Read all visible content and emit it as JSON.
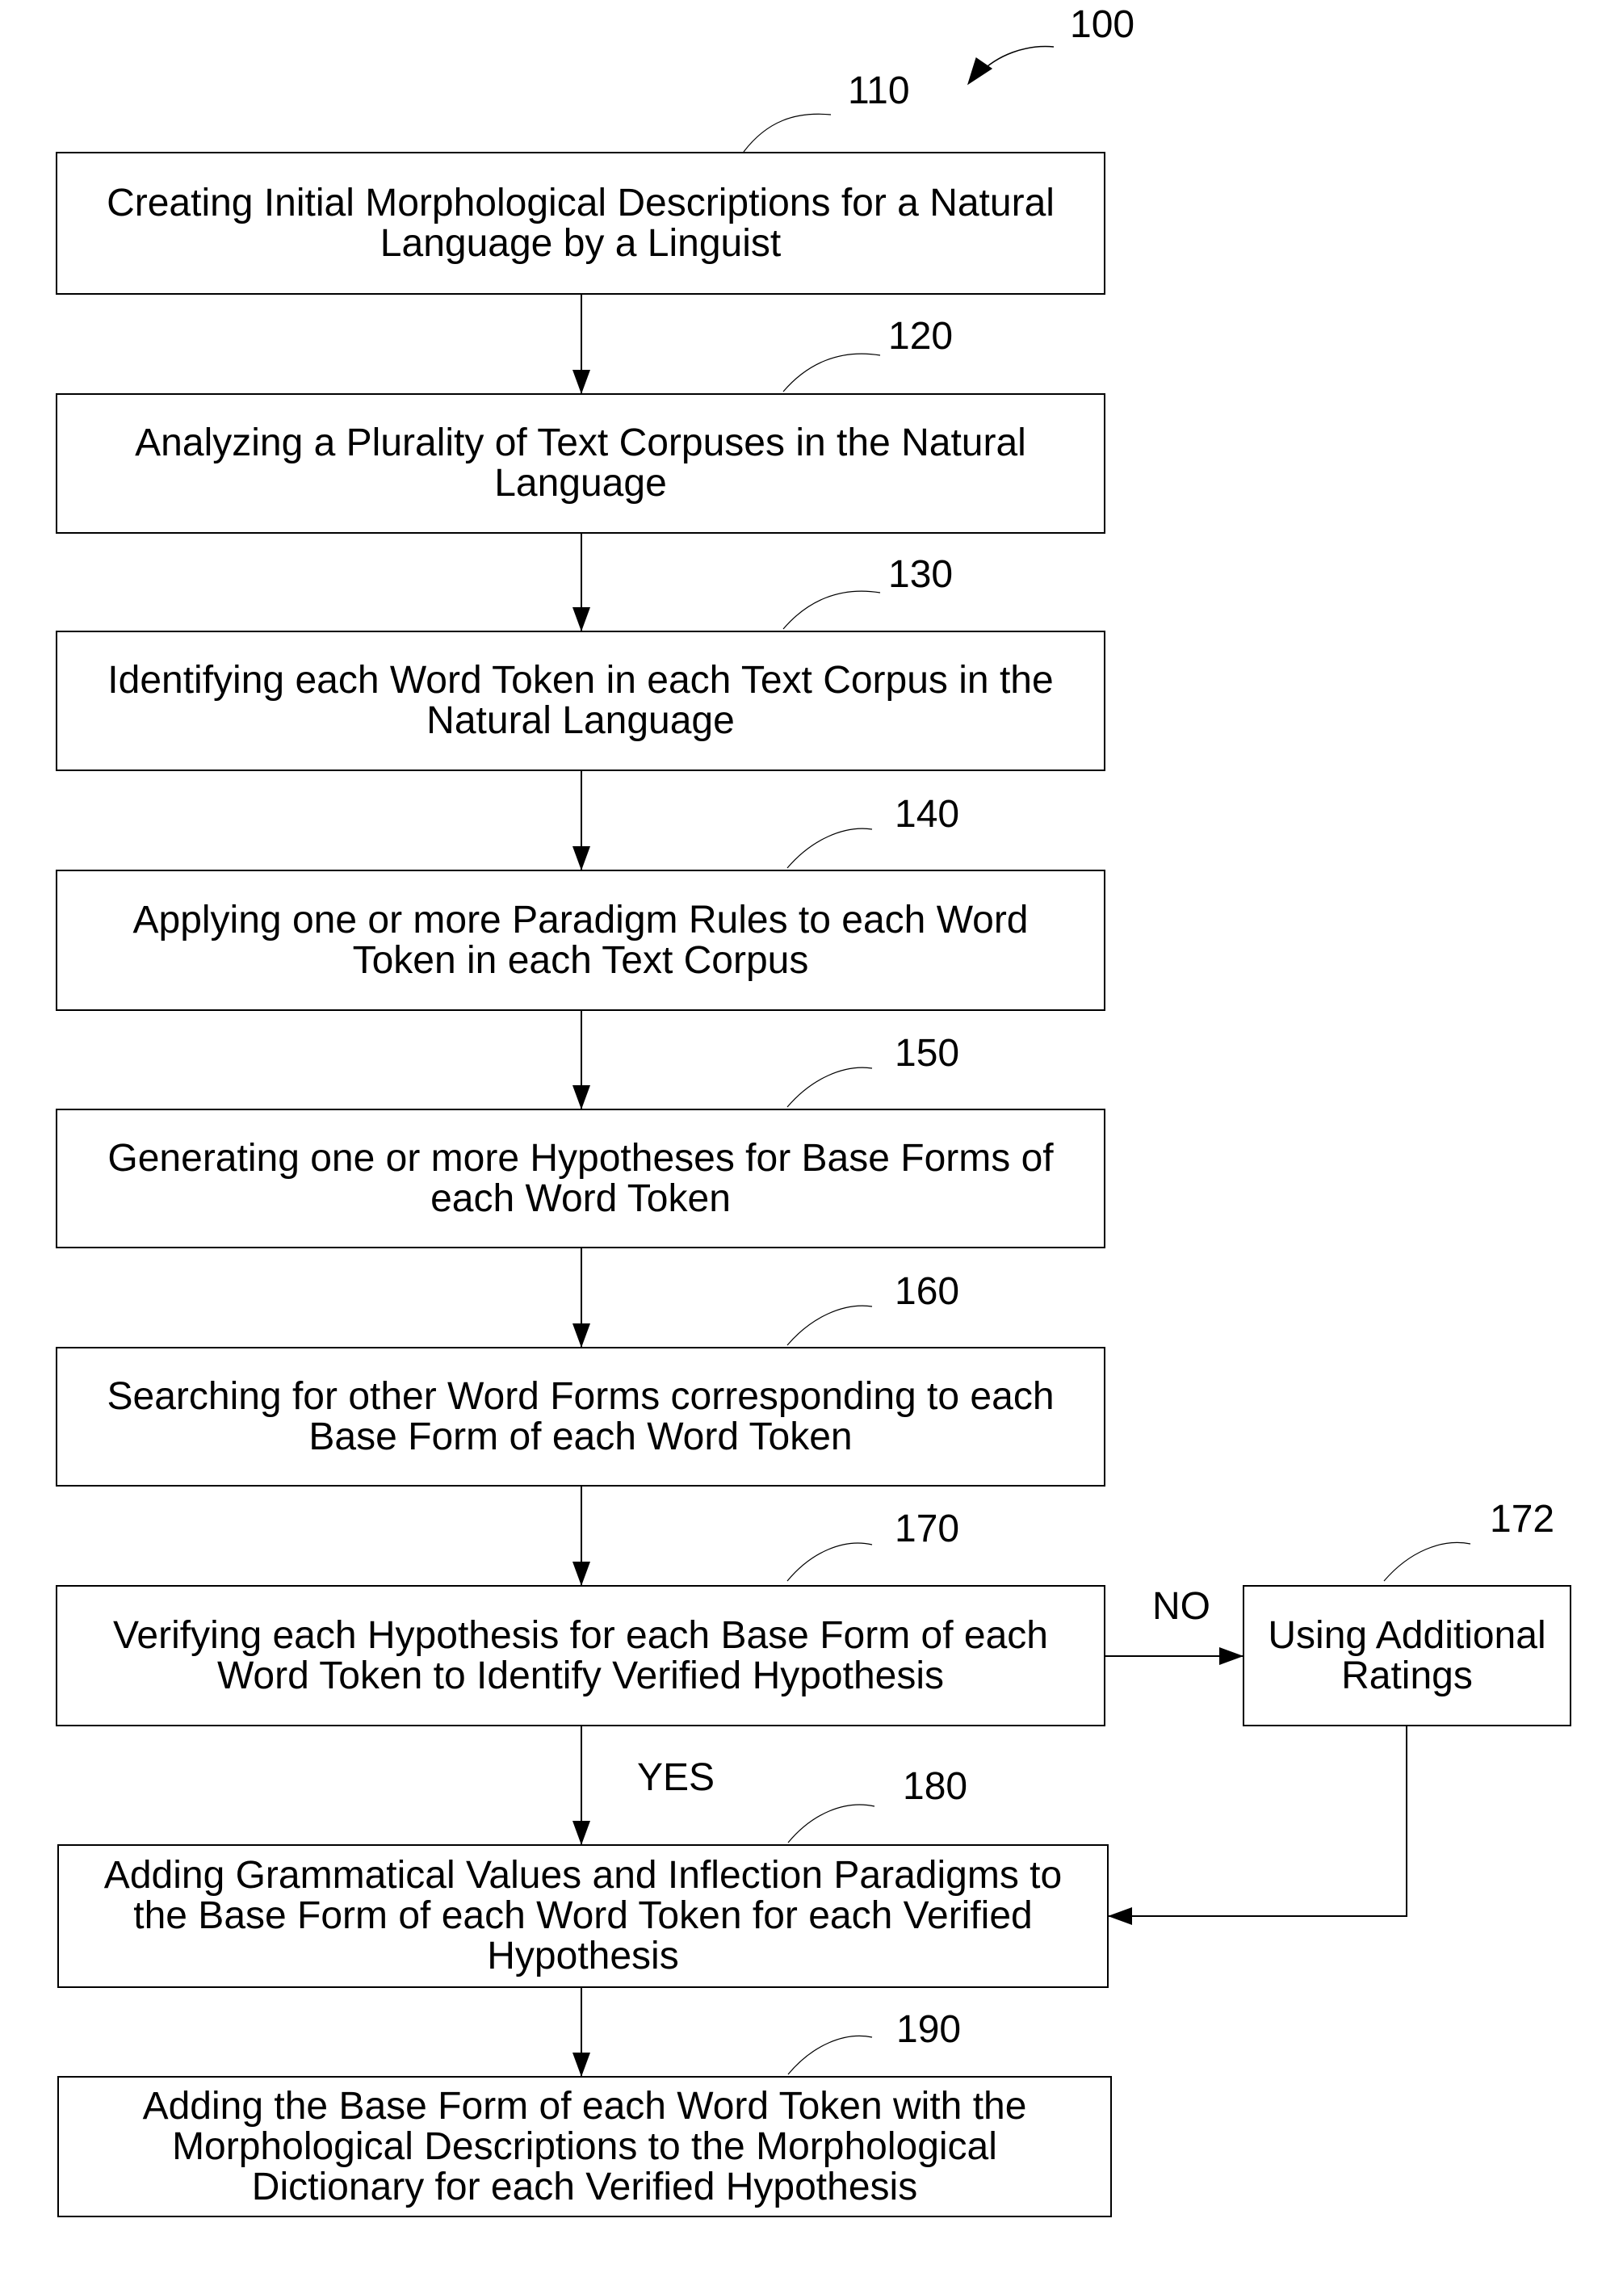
{
  "figure": {
    "reference": "100",
    "steps": [
      {
        "id": "110",
        "text": "Creating Initial Morphological Descriptions for a Natural\nLanguage by a Linguist"
      },
      {
        "id": "120",
        "text": "Analyzing a Plurality of Text Corpuses in the Natural\nLanguage"
      },
      {
        "id": "130",
        "text": "Identifying each Word Token in each Text Corpus in the\nNatural Language"
      },
      {
        "id": "140",
        "text": "Applying one or more Paradigm Rules to each Word\nToken in each Text Corpus"
      },
      {
        "id": "150",
        "text": "Generating one or more Hypotheses for Base Forms of\neach Word Token"
      },
      {
        "id": "160",
        "text": "Searching for other Word Forms corresponding to each\nBase Form of each Word Token"
      },
      {
        "id": "170",
        "text": "Verifying each Hypothesis for each Base Form of each\nWord Token to Identify Verified Hypothesis"
      },
      {
        "id": "172",
        "text": "Using Additional\nRatings"
      },
      {
        "id": "180",
        "text": "Adding Grammatical Values and Inflection Paradigms to\nthe Base Form of each Word Token for each Verified\nHypothesis"
      },
      {
        "id": "190",
        "text": "Adding the Base Form of each Word Token with the\nMorphological Descriptions to the Morphological\nDictionary for each Verified Hypothesis"
      }
    ],
    "branches": {
      "no_label": "NO",
      "yes_label": "YES"
    },
    "flow": [
      [
        "110",
        "120"
      ],
      [
        "120",
        "130"
      ],
      [
        "130",
        "140"
      ],
      [
        "140",
        "150"
      ],
      [
        "150",
        "160"
      ],
      [
        "160",
        "170"
      ],
      [
        "170",
        "180",
        "YES"
      ],
      [
        "170",
        "172",
        "NO"
      ],
      [
        "172",
        "180"
      ],
      [
        "180",
        "190"
      ]
    ]
  }
}
